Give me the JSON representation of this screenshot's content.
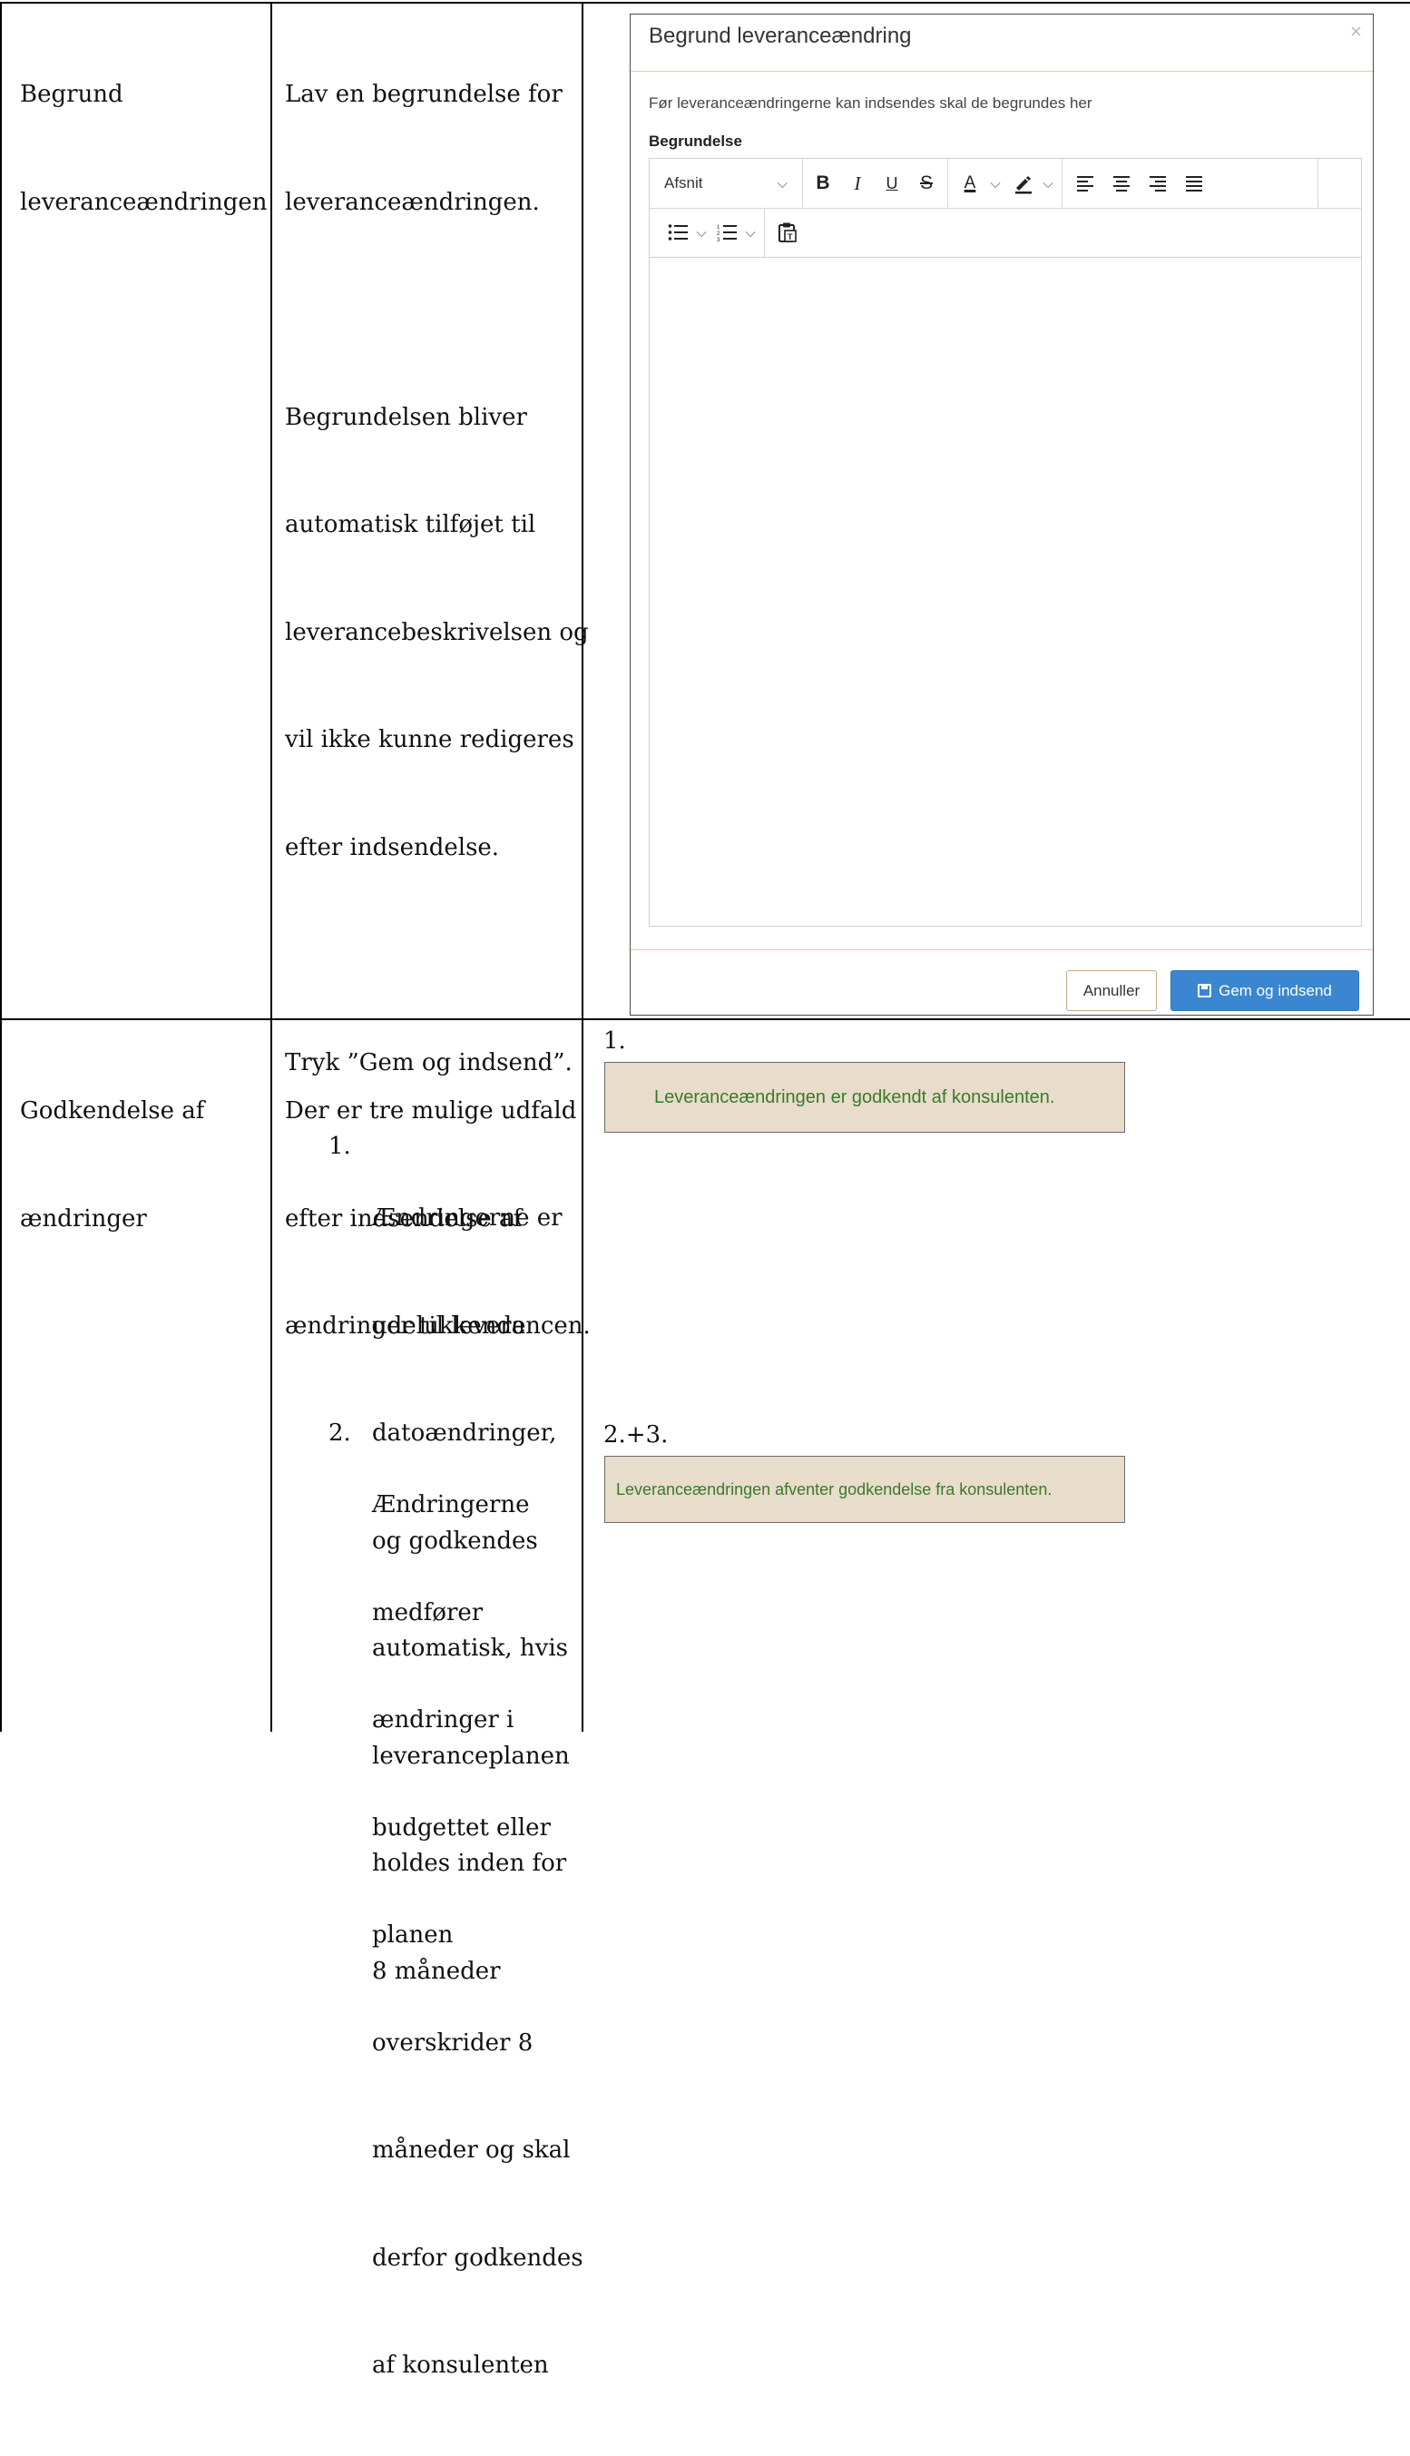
{
  "rows": [
    {
      "title_lines": [
        "Begrund",
        "leveranceændringen"
      ],
      "description_lines": [
        "Lav en begrundelse for",
        "leveranceændringen.",
        "",
        "Begrundelsen bliver",
        "automatisk tilføjet til",
        "leverancebeskrivelsen og",
        "vil ikke kunne redigeres",
        "efter indsendelse.",
        "",
        "Tryk ”Gem og indsend”."
      ]
    },
    {
      "title_lines": [
        "Godkendelse af",
        "ændringer"
      ],
      "intro_lines": [
        "Der er tre mulige udfald",
        "efter indsendelse af",
        "ændringer til leverancen."
      ],
      "list": [
        {
          "num": "1.",
          "lines": [
            "Ændringerne er",
            "udelukkende",
            "datoændringer,",
            "og godkendes",
            "automatisk, hvis",
            "leveranceplanen",
            "holdes inden for",
            "8 måneder"
          ]
        },
        {
          "num": "2.",
          "lines": [
            "Ændringerne",
            "medfører",
            "ændringer i",
            "budgettet eller",
            "planen",
            "overskrider 8",
            "måneder og skal",
            "derfor godkendes",
            "af konsulenten"
          ]
        }
      ]
    }
  ],
  "modal": {
    "title": "Begrund leveranceændring",
    "close": "×",
    "hint": "Før leveranceændringerne kan indsendes skal de begrundes her",
    "field_label": "Begrundelse",
    "editor": {
      "block_format": "Afsnit",
      "content": ""
    },
    "cancel_label": "Annuller",
    "save_label": "Gem og indsend",
    "save_color": "#3b86d0"
  },
  "outcomes": [
    {
      "label": "1.",
      "banner": "Leveranceændringen er godkendt af konsulenten."
    },
    {
      "label": "2.+3.",
      "banner": "Leveranceændringen afventer godkendelse fra konsulenten."
    }
  ],
  "colors": {
    "banner_bg": "#e8dccb",
    "banner_text": "#3a7a2a"
  }
}
